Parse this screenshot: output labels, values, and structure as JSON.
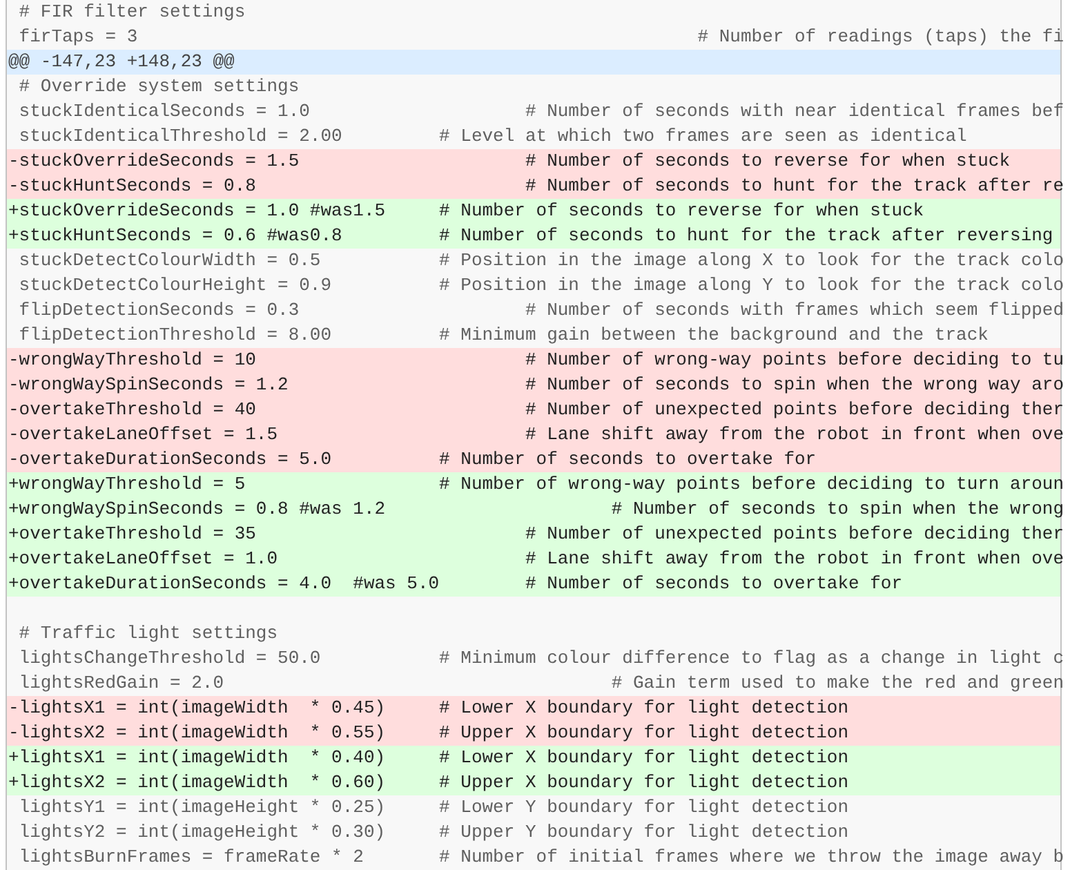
{
  "diff_lines": [
    {
      "kind": "context",
      "text": " # FIR filter settings"
    },
    {
      "kind": "context",
      "text": " firTaps = 3                                                    # Number of readings (taps) the fi"
    },
    {
      "kind": "hunk",
      "text": "@@ -147,23 +148,23 @@"
    },
    {
      "kind": "context",
      "text": " # Override system settings"
    },
    {
      "kind": "context",
      "text": " stuckIdenticalSeconds = 1.0                    # Number of seconds with near identical frames bef"
    },
    {
      "kind": "context",
      "text": " stuckIdenticalThreshold = 2.00         # Level at which two frames are seen as identical"
    },
    {
      "kind": "removed",
      "text": "-stuckOverrideSeconds = 1.5                     # Number of seconds to reverse for when stuck"
    },
    {
      "kind": "removed",
      "text": "-stuckHuntSeconds = 0.8                         # Number of seconds to hunt for the track after re"
    },
    {
      "kind": "added",
      "text": "+stuckOverrideSeconds = 1.0 #was1.5     # Number of seconds to reverse for when stuck"
    },
    {
      "kind": "added",
      "text": "+stuckHuntSeconds = 0.6 #was0.8         # Number of seconds to hunt for the track after reversing"
    },
    {
      "kind": "context",
      "text": " stuckDetectColourWidth = 0.5           # Position in the image along X to look for the track colo"
    },
    {
      "kind": "context",
      "text": " stuckDetectColourHeight = 0.9          # Position in the image along Y to look for the track colo"
    },
    {
      "kind": "context",
      "text": " flipDetectionSeconds = 0.3                     # Number of seconds with frames which seem flipped"
    },
    {
      "kind": "context",
      "text": " flipDetectionThreshold = 8.00          # Minimum gain between the background and the track"
    },
    {
      "kind": "removed",
      "text": "-wrongWayThreshold = 10                         # Number of wrong-way points before deciding to tu"
    },
    {
      "kind": "removed",
      "text": "-wrongWaySpinSeconds = 1.2                      # Number of seconds to spin when the wrong way aro"
    },
    {
      "kind": "removed",
      "text": "-overtakeThreshold = 40                         # Number of unexpected points before deciding ther"
    },
    {
      "kind": "removed",
      "text": "-overtakeLaneOffset = 1.5                       # Lane shift away from the robot in front when ove"
    },
    {
      "kind": "removed",
      "text": "-overtakeDurationSeconds = 5.0          # Number of seconds to overtake for"
    },
    {
      "kind": "added",
      "text": "+wrongWayThreshold = 5                  # Number of wrong-way points before deciding to turn aroun"
    },
    {
      "kind": "added",
      "text": "+wrongWaySpinSeconds = 0.8 #was 1.2                     # Number of seconds to spin when the wrong"
    },
    {
      "kind": "added",
      "text": "+overtakeThreshold = 35                         # Number of unexpected points before deciding ther"
    },
    {
      "kind": "added",
      "text": "+overtakeLaneOffset = 1.0                       # Lane shift away from the robot in front when ove"
    },
    {
      "kind": "added",
      "text": "+overtakeDurationSeconds = 4.0  #was 5.0        # Number of seconds to overtake for"
    },
    {
      "kind": "context"
    },
    {
      "kind": "context",
      "text": " # Traffic light settings"
    },
    {
      "kind": "context",
      "text": " lightsChangeThreshold = 50.0           # Minimum colour difference to flag as a change in light c"
    },
    {
      "kind": "context",
      "text": " lightsRedGain = 2.0                                    # Gain term used to make the red and green"
    },
    {
      "kind": "removed",
      "text": "-lightsX1 = int(imageWidth  * 0.45)     # Lower X boundary for light detection"
    },
    {
      "kind": "removed",
      "text": "-lightsX2 = int(imageWidth  * 0.55)     # Upper X boundary for light detection"
    },
    {
      "kind": "added",
      "text": "+lightsX1 = int(imageWidth  * 0.40)     # Lower X boundary for light detection"
    },
    {
      "kind": "added",
      "text": "+lightsX2 = int(imageWidth  * 0.60)     # Upper X boundary for light detection"
    },
    {
      "kind": "context",
      "text": " lightsY1 = int(imageHeight * 0.25)     # Lower Y boundary for light detection"
    },
    {
      "kind": "context",
      "text": " lightsY2 = int(imageHeight * 0.30)     # Upper Y boundary for light detection"
    },
    {
      "kind": "context",
      "text": " lightsBurnFrames = frameRate * 2       # Number of initial frames where we throw the image away b"
    }
  ]
}
